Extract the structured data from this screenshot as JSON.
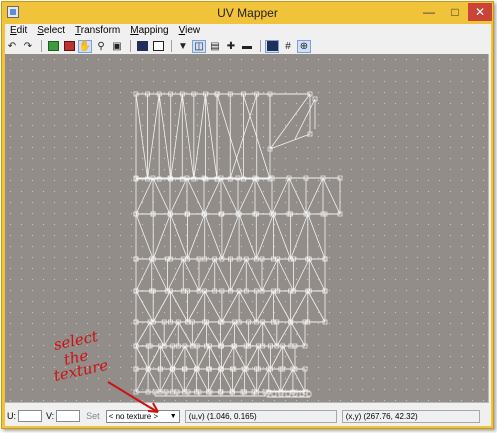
{
  "window": {
    "title": "UV Mapper"
  },
  "menu": [
    {
      "label": "Edit",
      "accel": "E",
      "rest": "dit"
    },
    {
      "label": "Select",
      "accel": "S",
      "rest": "elect"
    },
    {
      "label": "Transform",
      "accel": "T",
      "rest": "ransform"
    },
    {
      "label": "Mapping",
      "accel": "M",
      "rest": "apping"
    },
    {
      "label": "View",
      "accel": "V",
      "rest": "iew"
    }
  ],
  "toolbar": {
    "tools": [
      "undo-icon",
      "redo-icon",
      "select-icon",
      "pick-icon",
      "pan-hand-icon",
      "zoom-icon",
      "fit-icon",
      "select-all-icon",
      "deselect-icon",
      "filter-icon",
      "split-icon",
      "normal-icon",
      "add-icon",
      "remove-icon",
      "solid-view-icon",
      "grid-icon",
      "uv-center-icon"
    ],
    "active_tool": "pan-hand-icon"
  },
  "statusbar": {
    "u_label": "U:",
    "v_label": "V:",
    "u_value": "",
    "v_value": "",
    "set_label": "Set",
    "texture_selected": "< no texture >",
    "uv_readout": "(u,v) (1.046, 0.165)",
    "xy_readout": "(x,y) (267.76, 42.32)"
  },
  "annotation": {
    "text_lines": [
      "select",
      "the",
      "texture"
    ],
    "color": "#cc1111"
  },
  "colors": {
    "canvas_bg": "#928d89",
    "wire": "#f4f4f4",
    "title_bar": "#f0c33a",
    "close_button": "#c94337"
  }
}
